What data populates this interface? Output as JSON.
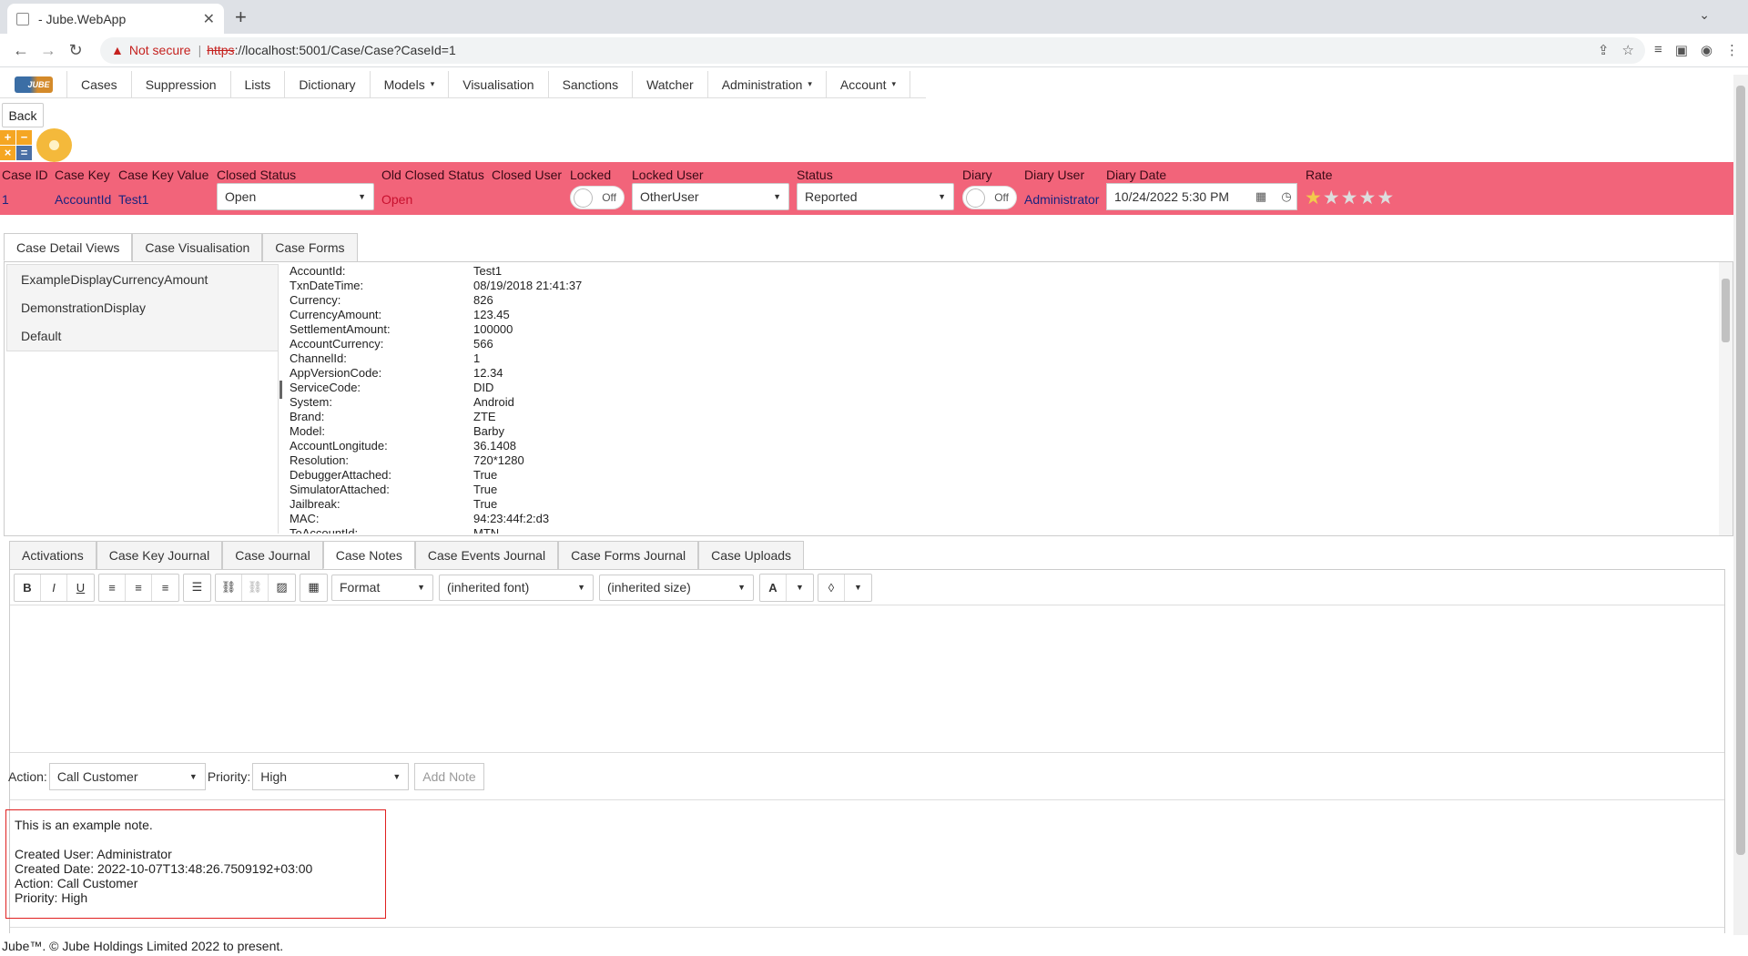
{
  "browser": {
    "tab_title": "- Jube.WebApp",
    "new_tab": "+",
    "not_secure": "Not secure",
    "url_scheme": "https",
    "url_rest": "://localhost:5001/Case/Case?CaseId=1"
  },
  "nav": {
    "items": [
      {
        "label": "Cases"
      },
      {
        "label": "Suppression"
      },
      {
        "label": "Lists"
      },
      {
        "label": "Dictionary"
      },
      {
        "label": "Models",
        "caret": "▾"
      },
      {
        "label": "Visualisation"
      },
      {
        "label": "Sanctions"
      },
      {
        "label": "Watcher"
      },
      {
        "label": "Administration",
        "caret": "▾"
      },
      {
        "label": "Account",
        "caret": "▾"
      }
    ]
  },
  "back_label": "Back",
  "case_header": {
    "labels": {
      "case_id": "Case ID",
      "case_key": "Case Key",
      "case_key_value": "Case Key Value",
      "closed_status": "Closed Status",
      "old_closed_status": "Old Closed Status",
      "closed_user": "Closed User",
      "locked": "Locked",
      "locked_user": "Locked User",
      "status": "Status",
      "diary": "Diary",
      "diary_user": "Diary User",
      "diary_date": "Diary Date",
      "rate": "Rate"
    },
    "values": {
      "case_id": "1",
      "case_key": "AccountId",
      "case_key_value": "Test1",
      "closed_status": "Open",
      "old_closed_status": "Open",
      "locked": "Off",
      "locked_user": "OtherUser",
      "status": "Reported",
      "diary": "Off",
      "diary_user": "Administrator",
      "diary_date": "10/24/2022 5:30 PM",
      "rating": 1,
      "rating_max": 5
    }
  },
  "detail_tabs": [
    "Case Detail Views",
    "Case Visualisation",
    "Case Forms"
  ],
  "detail_views": [
    "ExampleDisplayCurrencyAmount",
    "DemonstrationDisplay",
    "Default"
  ],
  "payload": [
    {
      "k": "AccountId:",
      "v": "Test1"
    },
    {
      "k": "TxnDateTime:",
      "v": "08/19/2018 21:41:37"
    },
    {
      "k": "Currency:",
      "v": "826"
    },
    {
      "k": "CurrencyAmount:",
      "v": "123.45"
    },
    {
      "k": "SettlementAmount:",
      "v": "100000"
    },
    {
      "k": "AccountCurrency:",
      "v": "566"
    },
    {
      "k": "ChannelId:",
      "v": "1"
    },
    {
      "k": "AppVersionCode:",
      "v": "12.34"
    },
    {
      "k": "ServiceCode:",
      "v": "DID"
    },
    {
      "k": "System:",
      "v": "Android"
    },
    {
      "k": "Brand:",
      "v": "ZTE"
    },
    {
      "k": "Model:",
      "v": "Barby"
    },
    {
      "k": "AccountLongitude:",
      "v": "36.1408"
    },
    {
      "k": "Resolution:",
      "v": "720*1280"
    },
    {
      "k": "DebuggerAttached:",
      "v": "True"
    },
    {
      "k": "SimulatorAttached:",
      "v": "True"
    },
    {
      "k": "Jailbreak:",
      "v": "True"
    },
    {
      "k": "MAC:",
      "v": "94:23:44f:2:d3"
    },
    {
      "k": "ToAccountId:",
      "v": "MTN"
    }
  ],
  "notes_tabs": [
    "Activations",
    "Case Key Journal",
    "Case Journal",
    "Case Notes",
    "Case Events Journal",
    "Case Forms Journal",
    "Case Uploads"
  ],
  "editor": {
    "format": "Format",
    "font": "(inherited font)",
    "size": "(inherited size)",
    "font_color_glyph": "A"
  },
  "action_row": {
    "action_label": "Action:",
    "action_value": "Call Customer",
    "priority_label": "Priority:",
    "priority_value": "High",
    "add_note": "Add Note"
  },
  "note": {
    "text": "This is an example note.",
    "created_user": "Created User: Administrator",
    "created_date": "Created Date: 2022-10-07T13:48:26.7509192+03:00",
    "action": "Action: Call Customer",
    "priority": "Priority: High"
  },
  "footer": "Jube™. © Jube Holdings Limited 2022 to present."
}
